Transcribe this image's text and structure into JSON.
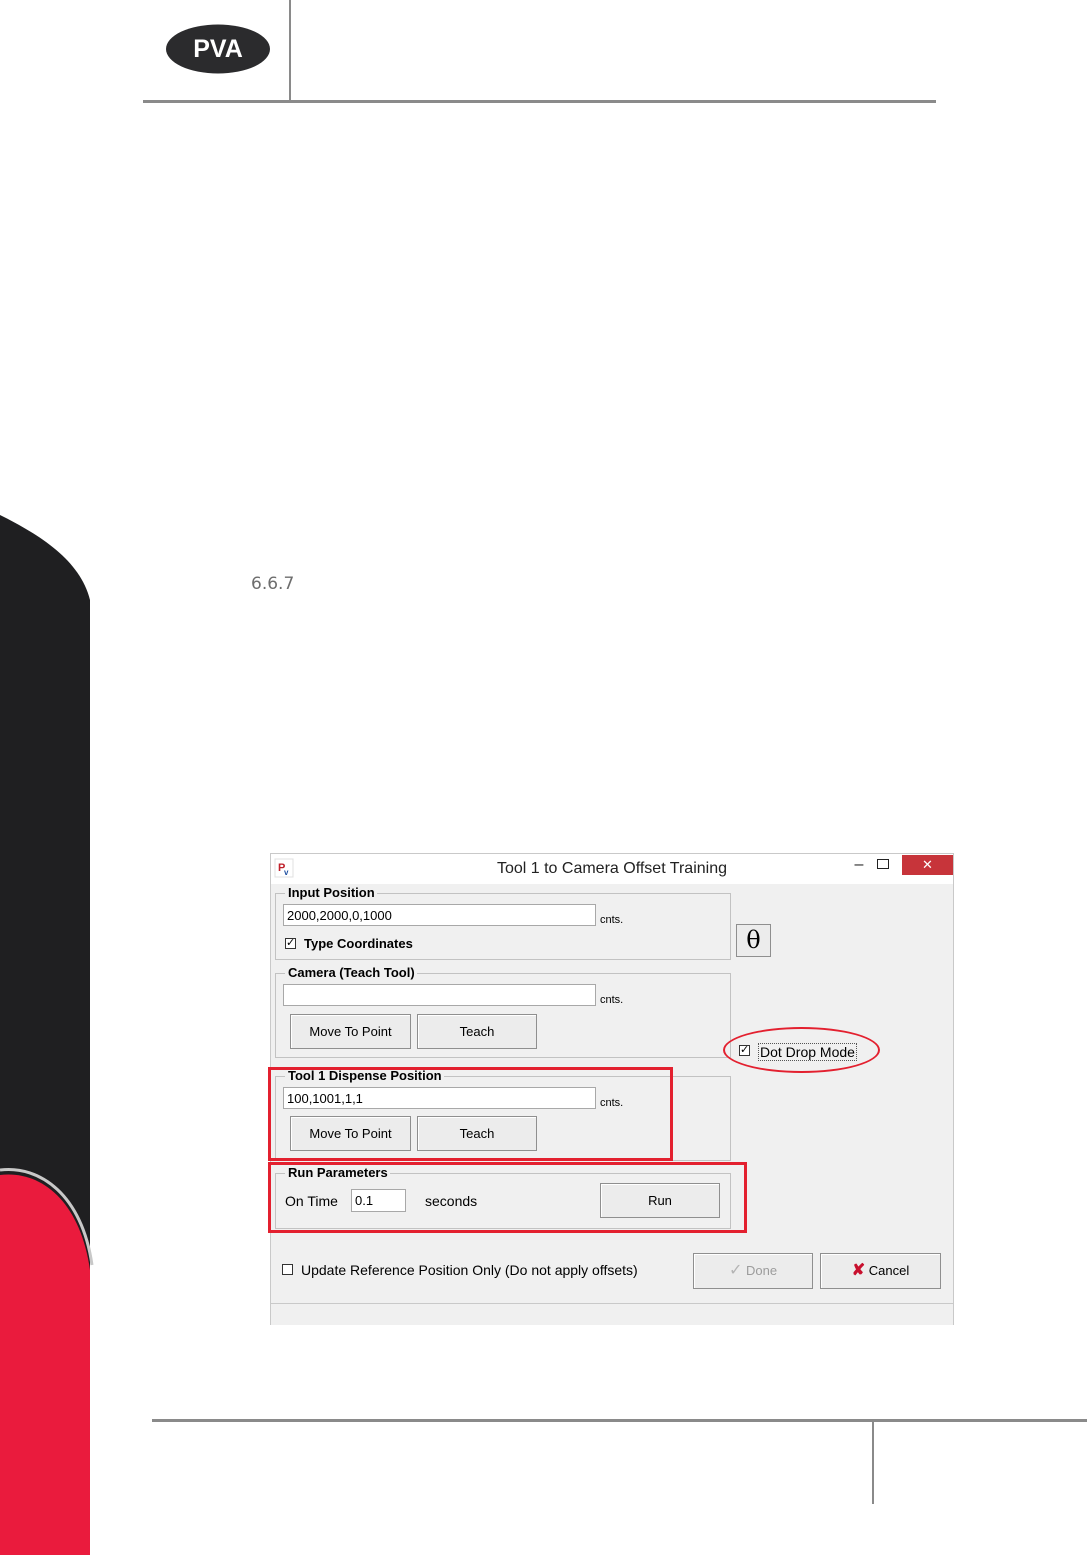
{
  "header": {
    "logo_text": "PVA"
  },
  "section": {
    "number": "6.6.7"
  },
  "dialog": {
    "title": "Tool 1 to Camera Offset Training",
    "titlebar_buttons": {
      "minimize": "–",
      "close": "✕"
    },
    "input_position": {
      "label": "Input Position",
      "value": "2000,2000,0,1000",
      "unit": "cnts.",
      "type_coordinates": {
        "label": "Type Coordinates",
        "checked": true
      }
    },
    "theta_button": "θ",
    "camera": {
      "label": "Camera (Teach Tool)",
      "value": "",
      "unit": "cnts.",
      "move_to_point": "Move To Point",
      "teach": "Teach"
    },
    "dot_drop_mode": {
      "label": "Dot Drop Mode",
      "checked": true
    },
    "tool1_dispense": {
      "label": "Tool 1 Dispense Position",
      "value": "100,1001,1,1",
      "unit": "cnts.",
      "move_to_point": "Move To Point",
      "teach": "Teach"
    },
    "run_parameters": {
      "label": "Run Parameters",
      "on_time_label": "On Time",
      "on_time_value": "0.1",
      "seconds_label": "seconds",
      "run": "Run"
    },
    "update_reference": {
      "label": "Update Reference Position Only (Do not apply offsets)",
      "checked": false
    },
    "done": "Done",
    "cancel": "Cancel"
  },
  "colors": {
    "brand_red": "#ea1b3d",
    "dark_band": "#1f1f21",
    "annotation_red": "#e3202f",
    "close_red": "#c7343a"
  }
}
